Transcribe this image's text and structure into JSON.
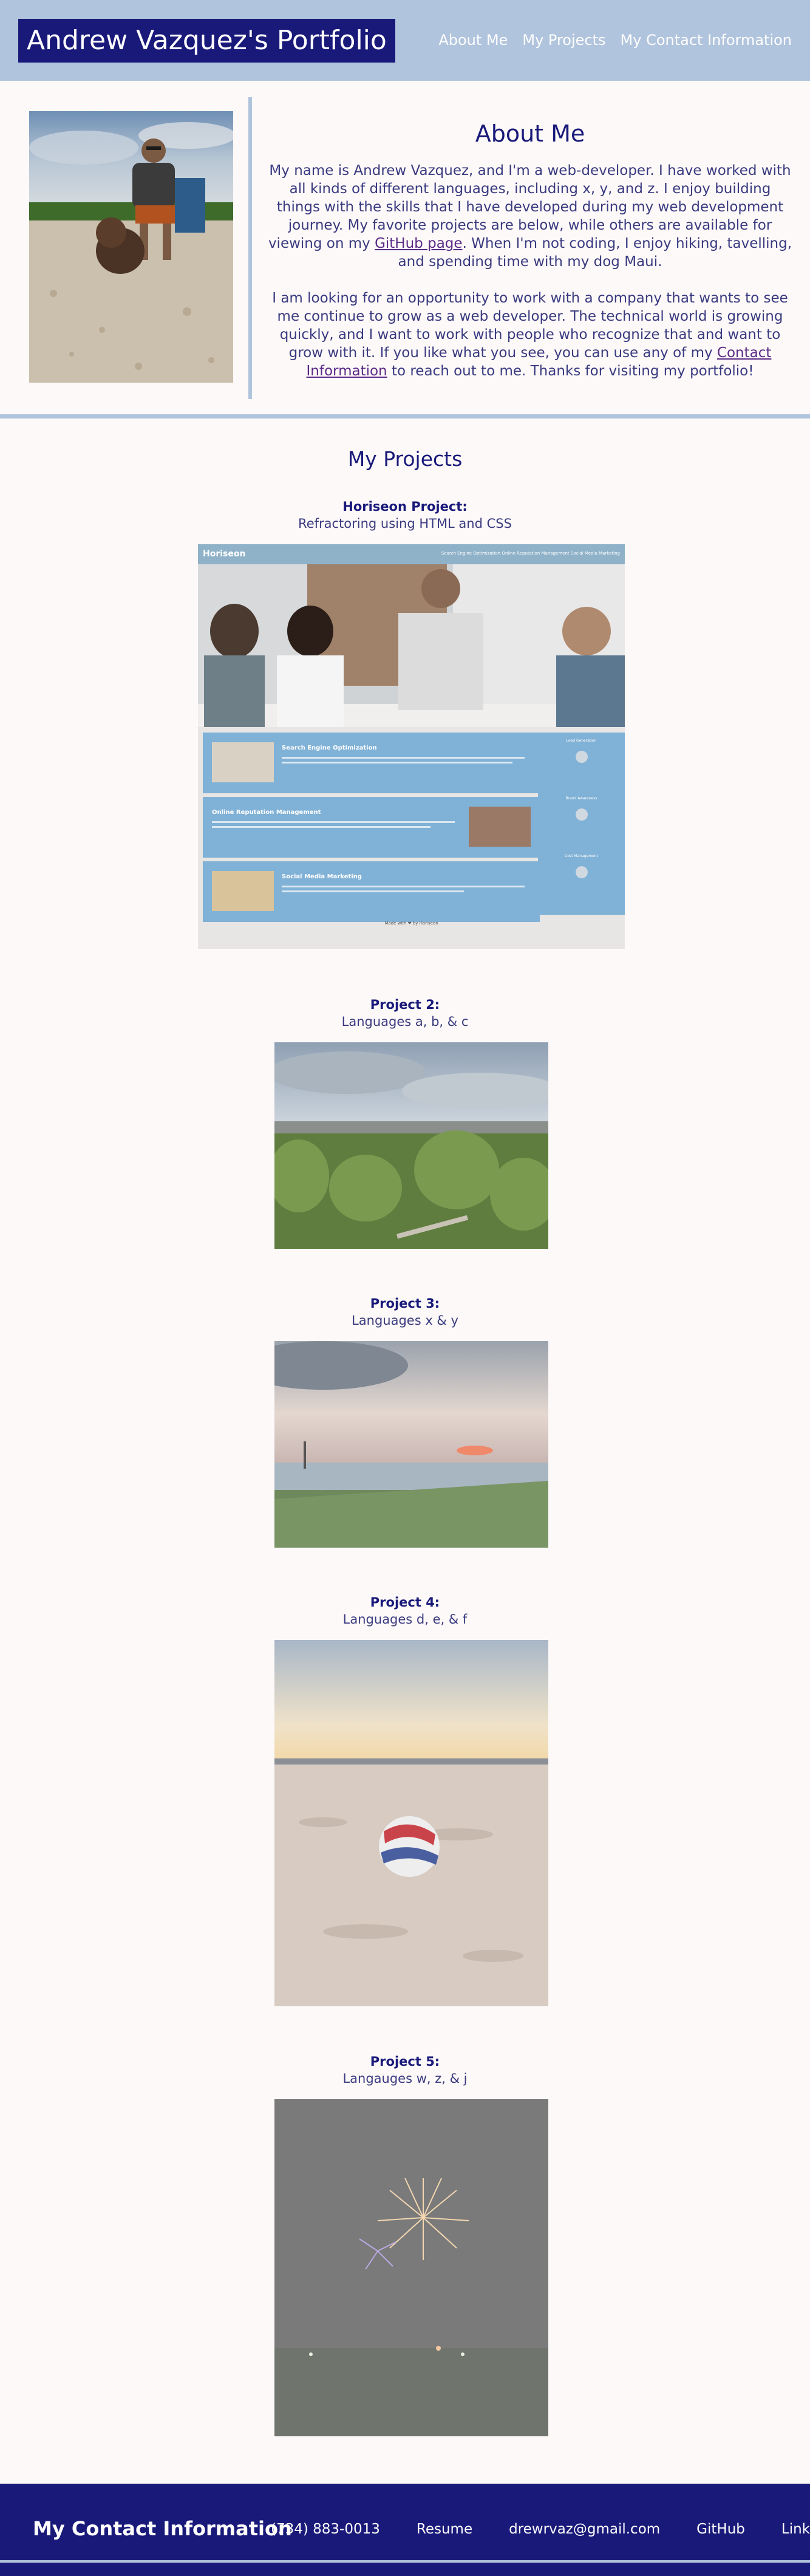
{
  "header": {
    "brand": "Andrew Vazquez's Portfolio",
    "nav": [
      "About Me",
      "My Projects",
      "My Contact Information"
    ]
  },
  "about": {
    "title": "About Me",
    "p1_before": "My name is Andrew Vazquez, and I'm a web-developer. I have worked with all kinds of different languages, including x, y, and z. I enjoy building things with the skills that I have developed during my web development journey. My favorite projects are below, while others are available for viewing on my ",
    "p1_link": "GitHub page",
    "p1_after": ". When I'm not coding, I enjoy hiking, tavelling, and spending time with my dog Maui.",
    "p2_before": "I am looking for an opportunity to work with a company that wants to see me continue to grow as a web developer. The technical world is growing quickly, and I want to work with people who recognize that and want to grow with it. If you like what you see, you can use any of my ",
    "p2_link": "Contact Information",
    "p2_after": " to reach out to me. Thanks for visiting my portfolio!"
  },
  "projects": {
    "heading": "My Projects",
    "items": [
      {
        "title": "Horiseon Project:",
        "desc": "Refractoring using HTML and CSS"
      },
      {
        "title": "Project 2:",
        "desc": "Languages a, b, & c"
      },
      {
        "title": "Project 3:",
        "desc": "Languages x & y"
      },
      {
        "title": "Project 4:",
        "desc": "Languages d, e, & f"
      },
      {
        "title": "Project 5:",
        "desc": "Langauges w, z, & j"
      }
    ]
  },
  "horiseon_mock": {
    "logo": "Horiseon",
    "nav": "Search Engine Optimization    Online Reputation Management    Social Media Marketing",
    "cards": [
      "Search Engine Optimization",
      "Online Reputation Management",
      "Social Media Marketing"
    ],
    "side": [
      "Lead Generation",
      "Brand Awareness",
      "Cost Management"
    ],
    "footer": "Made with ❤ by Horiseon"
  },
  "footer": {
    "title": "My Contact Information",
    "links": [
      "(734) 883-0013",
      "Resume",
      "drewrvaz@gmail.com",
      "GitHub",
      "LinkedIn"
    ]
  },
  "colors": {
    "navy": "#19197a",
    "light_blue": "#b1c4dd",
    "background": "#fcf9f8",
    "link_purple": "#5b2a86"
  },
  "icons": {
    "heart": "heart-icon"
  }
}
